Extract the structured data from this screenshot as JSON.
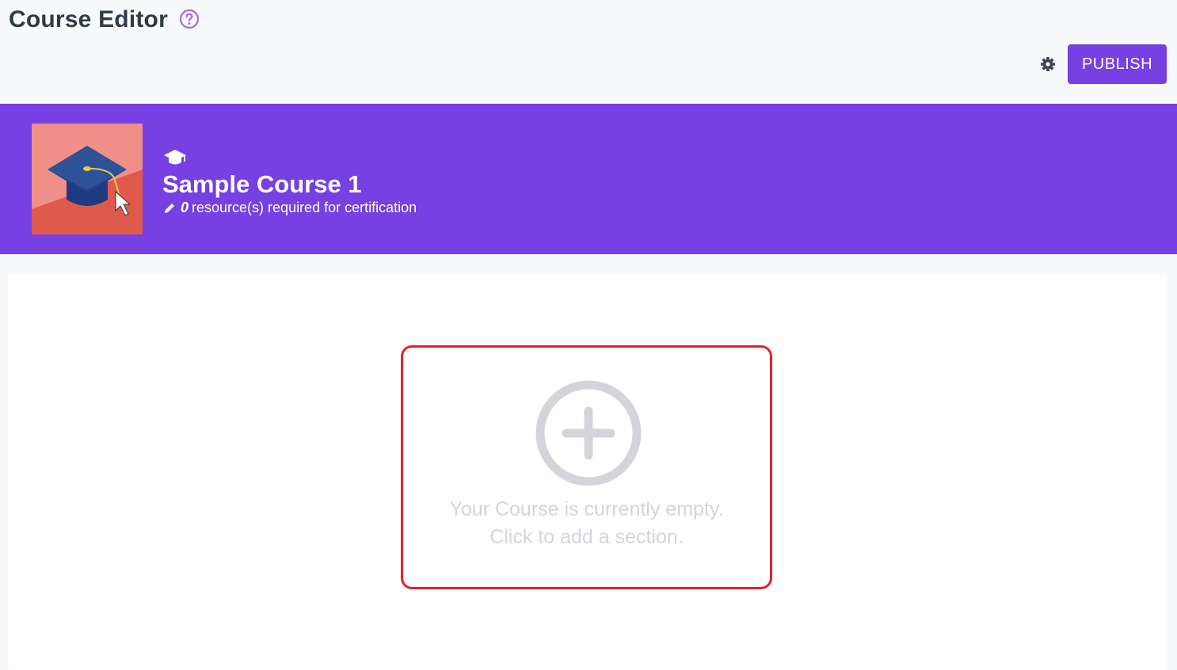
{
  "header": {
    "title": "Course Editor",
    "publish_label": "PUBLISH"
  },
  "course": {
    "name": "Sample Course 1",
    "required_count": "0",
    "required_suffix": "resource(s) required for certification"
  },
  "empty_state": {
    "line1": "Your Course is currently empty.",
    "line2": "Click to add a section."
  },
  "icons": {
    "help": "help-circle-icon",
    "settings": "gear-icon",
    "course_type": "graduation-cap-icon",
    "edit": "pencil-icon",
    "add": "plus-circle-icon"
  },
  "colors": {
    "accent": "#7640e3",
    "highlight_border": "#e0232b",
    "title_text": "#2f3a4a",
    "empty_text": "#d3d5da"
  }
}
